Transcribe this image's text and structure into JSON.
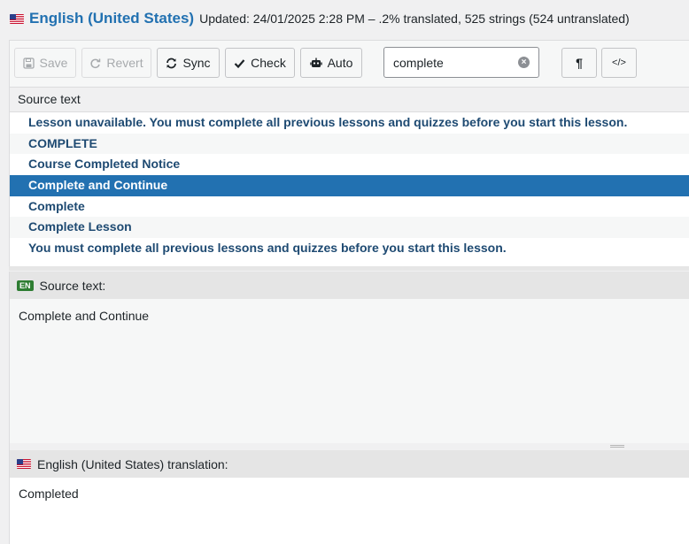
{
  "header": {
    "language": "English (United States)",
    "status": "Updated: 24/01/2025 2:28 PM – .2% translated, 525 strings (524 untranslated)"
  },
  "toolbar": {
    "save": "Save",
    "revert": "Revert",
    "sync": "Sync",
    "check": "Check",
    "auto": "Auto",
    "search_value": "complete",
    "pilcrow": "¶",
    "code": "</>"
  },
  "list": {
    "header": "Source text",
    "rows": [
      "Lesson unavailable. You must complete all previous lessons and quizzes before you start this lesson.",
      "COMPLETE",
      "Course Completed Notice",
      "Complete and Continue",
      "Complete",
      "Complete Lesson",
      "You must complete all previous lessons and quizzes before you start this lesson."
    ],
    "selected_index": 3
  },
  "source": {
    "badge": "EN",
    "label": "Source text:",
    "text": "Complete and Continue"
  },
  "translation": {
    "label": "English (United States) translation:",
    "text": "Completed"
  },
  "colors": {
    "accent": "#2271b1",
    "row_text": "#1e4a72",
    "en_badge": "#2e7d32"
  }
}
